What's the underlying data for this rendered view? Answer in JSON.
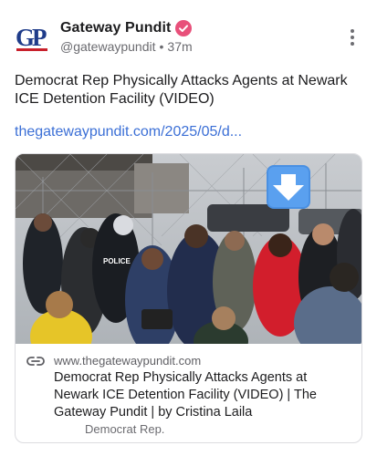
{
  "account": {
    "display_name": "Gateway Pundit",
    "handle": "@gatewaypundit",
    "separator": "•",
    "timestamp": "37m",
    "avatar_text": "GP",
    "verified": true
  },
  "post": {
    "text": "Democrat Rep Physically Attacks Agents at Newark ICE Detention Facility (VIDEO)",
    "link_text": "thegatewaypundit.com/2025/05/d..."
  },
  "link_card": {
    "image_badges": [
      "POLICE"
    ],
    "domain": "www.thegatewaypundit.com",
    "title": "Democrat Rep Physically Attacks Agents at Newark ICE Detention Facility (VIDEO) | The Gateway Pundit | by Cristina Laila",
    "description": "Democrat Rep."
  },
  "icons": {
    "verified": "verified-badge-icon",
    "more": "more-vertical-icon",
    "link": "link-icon",
    "download": "down-arrow-icon"
  },
  "colors": {
    "accent_link": "#3b6fd6",
    "verified_badge": "#e8507a",
    "avatar_blue": "#1f3c8a",
    "avatar_red": "#c8202b",
    "download_button": "#4a90e2"
  }
}
